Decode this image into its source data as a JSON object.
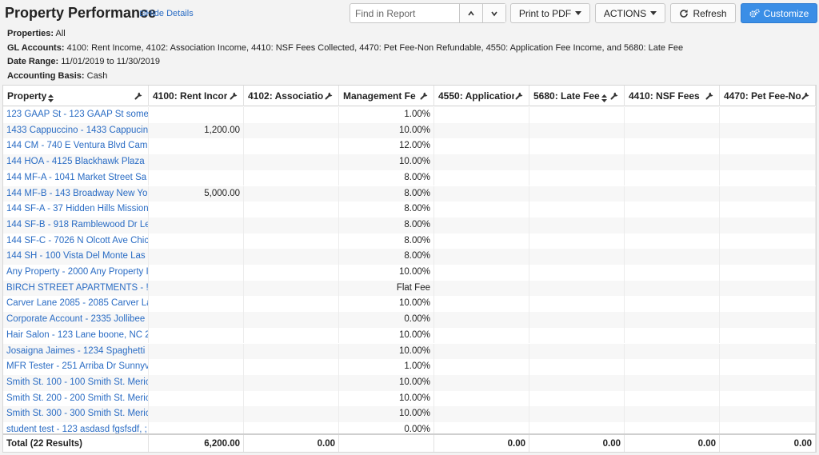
{
  "header": {
    "title": "Property Performance",
    "hide_details": "Hide Details",
    "find_placeholder": "Find in Report",
    "print_label": "Print to PDF",
    "actions_label": "ACTIONS",
    "refresh_label": "Refresh",
    "customize_label": "Customize"
  },
  "details": {
    "properties_label": "Properties:",
    "properties_value": "All",
    "gl_label": "GL Accounts:",
    "gl_value": "4100: Rent Income, 4102: Association Income, 4410: NSF Fees Collected, 4470: Pet Fee-Non Refundable, 4550: Application Fee Income, and 5680: Late Fee",
    "date_label": "Date Range:",
    "date_value": "11/01/2019 to 11/30/2019",
    "basis_label": "Accounting Basis:",
    "basis_value": "Cash"
  },
  "table": {
    "columns": [
      {
        "label": "Property",
        "sortable": true
      },
      {
        "label": "4100: Rent Incor",
        "sortable": false
      },
      {
        "label": "4102: Associatio",
        "sortable": false
      },
      {
        "label": "Management Fe",
        "sortable": false
      },
      {
        "label": "4550: Applicatior",
        "sortable": false
      },
      {
        "label": "5680: Late Fee",
        "sortable": true
      },
      {
        "label": "4410: NSF Fees",
        "sortable": false
      },
      {
        "label": "4470: Pet Fee-No",
        "sortable": false
      }
    ],
    "rows": [
      {
        "property": "123 GAAP St - 123 GAAP St some",
        "rent": "",
        "mgmt": "1.00%"
      },
      {
        "property": "1433 Cappuccino - 1433 Cappucin",
        "rent": "1,200.00",
        "mgmt": "10.00%"
      },
      {
        "property": "144 CM - 740 E Ventura Blvd Cam",
        "rent": "",
        "mgmt": "12.00%"
      },
      {
        "property": "144 HOA - 4125 Blackhawk Plaza",
        "rent": "",
        "mgmt": "10.00%"
      },
      {
        "property": "144 MF-A - 1041 Market Street Sa",
        "rent": "",
        "mgmt": "8.00%"
      },
      {
        "property": "144 MF-B - 143 Broadway New Yo",
        "rent": "5,000.00",
        "mgmt": "8.00%"
      },
      {
        "property": "144 SF-A - 37 Hidden Hills Mission",
        "rent": "",
        "mgmt": "8.00%"
      },
      {
        "property": "144 SF-B - 918 Ramblewood Dr Le",
        "rent": "",
        "mgmt": "8.00%"
      },
      {
        "property": "144 SF-C - 7026 N Olcott Ave Chic",
        "rent": "",
        "mgmt": "8.00%"
      },
      {
        "property": "144 SH - 100 Vista Del Monte Las",
        "rent": "",
        "mgmt": "8.00%"
      },
      {
        "property": "Any Property - 2000 Any Property I",
        "rent": "",
        "mgmt": "10.00%"
      },
      {
        "property": "BIRCH STREET APARTMENTS - !",
        "rent": "",
        "mgmt": "Flat Fee"
      },
      {
        "property": "Carver Lane 2085 - 2085 Carver La",
        "rent": "",
        "mgmt": "10.00%"
      },
      {
        "property": "Corporate Account - 2335 Jollibee",
        "rent": "",
        "mgmt": "0.00%"
      },
      {
        "property": "Hair Salon - 123 Lane boone, NC 2",
        "rent": "",
        "mgmt": "10.00%"
      },
      {
        "property": "Josaigna Jaimes - 1234 Spaghetti",
        "rent": "",
        "mgmt": "10.00%"
      },
      {
        "property": "MFR Tester - 251 Arriba Dr Sunnyv",
        "rent": "",
        "mgmt": "1.00%"
      },
      {
        "property": "Smith St. 100 - 100 Smith St. Meric",
        "rent": "",
        "mgmt": "10.00%"
      },
      {
        "property": "Smith St. 200 - 200 Smith St. Meric",
        "rent": "",
        "mgmt": "10.00%"
      },
      {
        "property": "Smith St. 300 - 300 Smith St. Meric",
        "rent": "",
        "mgmt": "10.00%"
      },
      {
        "property": "student test - 123 asdasd fgsfsdf, ;",
        "rent": "",
        "mgmt": "0.00%"
      }
    ],
    "totals": {
      "label": "Total (22 Results)",
      "rent": "6,200.00",
      "assoc": "0.00",
      "mgmt": "",
      "app": "0.00",
      "late": "0.00",
      "nsf": "0.00",
      "pet": "0.00"
    }
  }
}
